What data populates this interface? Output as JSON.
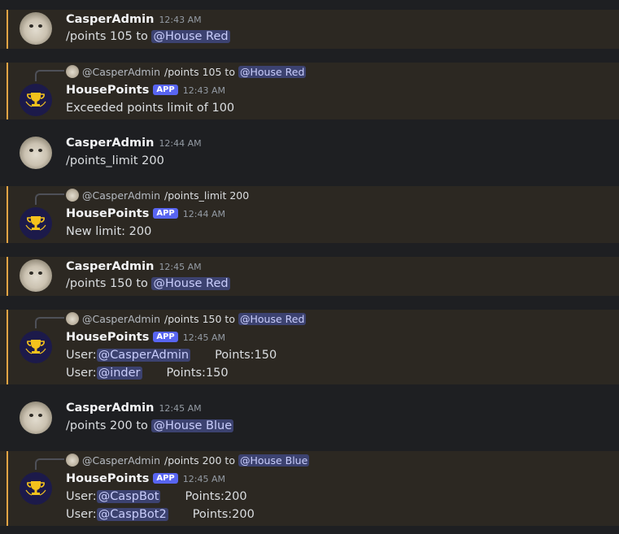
{
  "messages": [
    {
      "user": "CasperAdmin",
      "time": "12:43 AM",
      "text_prefix": "/points 105 to ",
      "mention": "@House Red"
    },
    {
      "reply_user": "@CasperAdmin",
      "reply_text": "/points 105 to",
      "reply_mention": "@House Red",
      "user": "HousePoints",
      "badge": "APP",
      "time": "12:43 AM",
      "line1": "Exceeded points limit of 100"
    },
    {
      "user": "CasperAdmin",
      "time": "12:44 AM",
      "text": "/points_limit 200"
    },
    {
      "reply_user": "@CasperAdmin",
      "reply_text": "/points_limit 200",
      "user": "HousePoints",
      "badge": "APP",
      "time": "12:44 AM",
      "line1": "New limit: 200"
    },
    {
      "user": "CasperAdmin",
      "time": "12:45 AM",
      "text_prefix": "/points 150 to ",
      "mention": "@House Red"
    },
    {
      "reply_user": "@CasperAdmin",
      "reply_text": "/points 150 to",
      "reply_mention": "@House Red",
      "user": "HousePoints",
      "badge": "APP",
      "time": "12:45 AM",
      "rows": [
        {
          "label": "User:",
          "mention": "@CasperAdmin",
          "points": "Points:150"
        },
        {
          "label": "User:",
          "mention": "@inder",
          "points": "Points:150"
        }
      ]
    },
    {
      "user": "CasperAdmin",
      "time": "12:45 AM",
      "text_prefix": "/points 200 to ",
      "mention": "@House Blue"
    },
    {
      "reply_user": "@CasperAdmin",
      "reply_text": "/points 200 to",
      "reply_mention": "@House Blue",
      "user": "HousePoints",
      "badge": "APP",
      "time": "12:45 AM",
      "rows": [
        {
          "label": "User:",
          "mention": "@CaspBot",
          "points": "Points:200"
        },
        {
          "label": "User:",
          "mention": "@CaspBot2",
          "points": "Points:200"
        }
      ]
    }
  ],
  "colors": {
    "background": "#1e1f22",
    "highlight": "#2c2822",
    "highlight_bar": "#e3a444",
    "mention_bg": "#3c4270",
    "badge": "#5865f2"
  },
  "icons": {
    "user_avatar": "cat-avatar-icon",
    "bot_avatar": "trophy-icon"
  }
}
